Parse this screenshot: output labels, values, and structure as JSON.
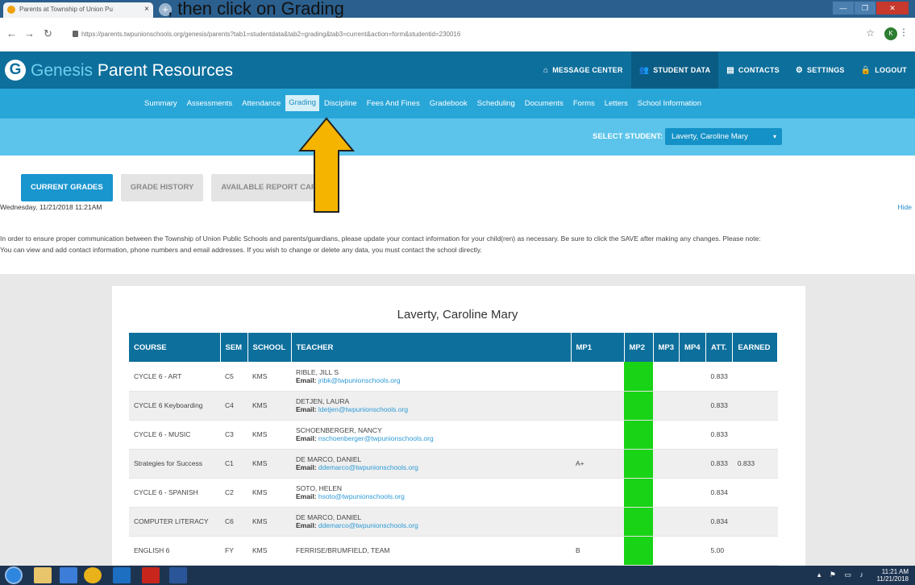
{
  "browser": {
    "tab_title": "Parents at Township of Union Pu",
    "tab_close": "×",
    "new_tab": "+",
    "window_title": "",
    "url": "https://parents.twpunionschools.org/genesis/parents?tab1=studentdata&tab2=grading&tab3=current&action=form&studentid=230016",
    "profile_initial": "K"
  },
  "caption_fragment": ", then click on Grading",
  "app": {
    "logo_letter": "G",
    "brand_main": "Genesis",
    "brand_sub": " Parent Resources"
  },
  "top_nav": [
    {
      "icon": "⌂",
      "label": "MESSAGE CENTER"
    },
    {
      "icon": "👥",
      "label": "STUDENT DATA"
    },
    {
      "icon": "▤",
      "label": "CONTACTS"
    },
    {
      "icon": "⚙",
      "label": "SETTINGS"
    },
    {
      "icon": "🔒",
      "label": "LOGOUT"
    }
  ],
  "sub_nav": [
    "Summary",
    "Assessments",
    "Attendance",
    "Grading",
    "Discipline",
    "Fees And Fines",
    "Gradebook",
    "Scheduling",
    "Documents",
    "Forms",
    "Letters",
    "School Information"
  ],
  "student_select": {
    "label": "SELECT STUDENT:",
    "value": "Laverty, Caroline Mary",
    "caret": "▾"
  },
  "buttons": {
    "current": "CURRENT GRADES",
    "history": "GRADE HISTORY",
    "report": "AVAILABLE REPORT CARDS"
  },
  "timestamp": "Wednesday, 11/21/2018 11:21AM",
  "hide_label": "Hide",
  "notice": {
    "line1": "In order to ensure proper communication between the Township of Union Public Schools and parents/guardians, please update your contact information for your child(ren) as necessary. Be sure to click the SAVE after making any changes. Please note:",
    "line2": "You can view and add contact information, phone numbers and email addresses. If you wish to change or delete any data, you must contact the school directly."
  },
  "student_name": "Laverty, Caroline Mary",
  "table": {
    "headers": [
      "COURSE",
      "SEM",
      "SCHOOL",
      "TEACHER",
      "MP1",
      "MP2",
      "MP3",
      "MP4",
      "ATT.",
      "EARNED"
    ],
    "email_label": "Email:",
    "rows": [
      {
        "course": "CYCLE 6 - ART",
        "sem": "C5",
        "school": "KMS",
        "teacher": "RIBLE, JILL S",
        "email": "jribk@twpunionschools.org",
        "mp1": "",
        "att": "0.833",
        "earned": ""
      },
      {
        "course": "CYCLE 6 Keyboarding",
        "sem": "C4",
        "school": "KMS",
        "teacher": "DETJEN, LAURA",
        "email": "ldetjen@twpunionschools.org",
        "mp1": "",
        "att": "0.833",
        "earned": ""
      },
      {
        "course": "CYCLE 6 - MUSIC",
        "sem": "C3",
        "school": "KMS",
        "teacher": "SCHOENBERGER, NANCY",
        "email": "nschoenberger@twpunionschools.org",
        "mp1": "",
        "att": "0.833",
        "earned": ""
      },
      {
        "course": "Strategies for Success",
        "sem": "C1",
        "school": "KMS",
        "teacher": "DE MARCO, DANIEL",
        "email": "ddemarco@twpunionschools.org",
        "mp1": "A+",
        "att": "0.833",
        "earned": "0.833"
      },
      {
        "course": "CYCLE 6 - SPANISH",
        "sem": "C2",
        "school": "KMS",
        "teacher": "SOTO, HELEN",
        "email": "hsoto@twpunionschools.org",
        "mp1": "",
        "att": "0.834",
        "earned": ""
      },
      {
        "course": "COMPUTER LITERACY",
        "sem": "C6",
        "school": "KMS",
        "teacher": "DE MARCO, DANIEL",
        "email": "ddemarco@twpunionschools.org",
        "mp1": "",
        "att": "0.834",
        "earned": ""
      },
      {
        "course": "ENGLISH 6",
        "sem": "FY",
        "school": "KMS",
        "teacher": "FERRISE/BRUMFIELD, TEAM",
        "email": "",
        "mp1": "B",
        "att": "5.00",
        "earned": ""
      }
    ]
  },
  "taskbar": {
    "time": "11:21 AM",
    "date": "11/21/2018"
  },
  "colors": {
    "header": "#0d6f9c",
    "subnav": "#29a6d8",
    "student_bar": "#5cc4ea",
    "mp2_highlight": "#19d316",
    "arrow": "#f5b400"
  }
}
